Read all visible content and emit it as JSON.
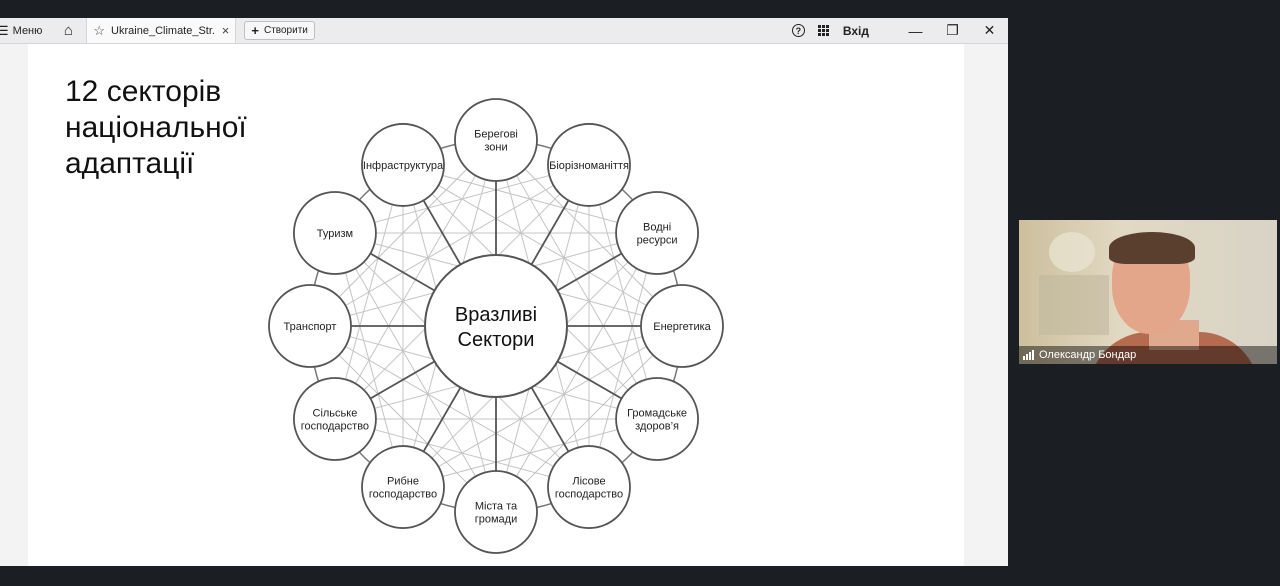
{
  "toolbar": {
    "menu_label": "Меню",
    "tab_title": "Ukraine_Climate_Str...",
    "create_label": "Створити",
    "login_label": "Вхід"
  },
  "slide": {
    "title": "12 секторів\nнаціональної\nадаптації",
    "center_label_line1": "Вразливі",
    "center_label_line2": "Сектори",
    "sectors": [
      {
        "lines": [
          "Берегові",
          "зони"
        ]
      },
      {
        "lines": [
          "Біорізноманіття"
        ]
      },
      {
        "lines": [
          "Водні",
          "ресурси"
        ]
      },
      {
        "lines": [
          "Енергетика"
        ]
      },
      {
        "lines": [
          "Громадське",
          "здоров’я"
        ]
      },
      {
        "lines": [
          "Лісове",
          "господарство"
        ]
      },
      {
        "lines": [
          "Міста та",
          "громади"
        ]
      },
      {
        "lines": [
          "Рибне",
          "господарство"
        ]
      },
      {
        "lines": [
          "Сільське",
          "господарство"
        ]
      },
      {
        "lines": [
          "Транспорт"
        ]
      },
      {
        "lines": [
          "Туризм"
        ]
      },
      {
        "lines": [
          "Інфраструктура"
        ]
      }
    ]
  },
  "video": {
    "participant_name": "Олександр Бондар"
  }
}
